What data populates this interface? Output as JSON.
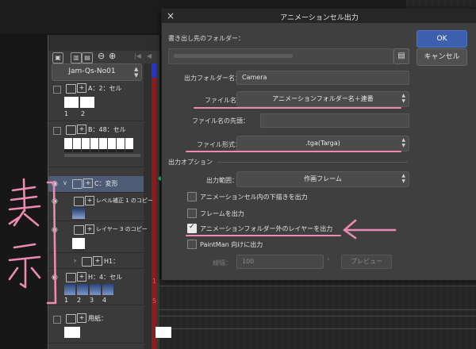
{
  "timeline": {
    "sequence": "Jam-Qs-No01",
    "rows": [
      {
        "label": "A：2：セル",
        "nums": [
          "1",
          "2"
        ]
      },
      {
        "label": "B：48：セル"
      },
      {
        "label": "C：変形"
      },
      {
        "label": "レベル補正 1 のコピー"
      },
      {
        "label": "レイヤー 3 のコピー"
      },
      {
        "label": "H1："
      },
      {
        "label": "H：4：セル",
        "nums": [
          "1",
          "2",
          "3",
          "4"
        ]
      },
      {
        "label": "用紙："
      }
    ],
    "frame_marks": [
      "1",
      "5"
    ]
  },
  "annotation": {
    "handwriting": "表示",
    "color": "#ec8ab2"
  },
  "dialog": {
    "title": "アニメーションセル出力",
    "ok": "OK",
    "cancel": "キャンセル",
    "dest_folder_label": "書き出し先のフォルダー：",
    "output_folder_label": "出力フォルダー名：",
    "output_folder_value": "Camera",
    "filename_label": "ファイル名：",
    "filename_value": "アニメーションフォルダー名＋連番",
    "filename_prefix_label": "ファイル名の先頭：",
    "filename_prefix_value": "",
    "format_label": "ファイル形式：",
    "format_value": ".tga(Targa)",
    "options_section": "出力オプション",
    "range_label": "出力範囲：",
    "range_value": "作画フレーム",
    "checkboxes": [
      {
        "label": "アニメーションセル内の下描きを出力",
        "checked": false
      },
      {
        "label": "フレームを出力",
        "checked": false
      },
      {
        "label": "アニメーションフォルダー外のレイヤーを出力",
        "checked": true
      },
      {
        "label": "PaintMan 向けに出力",
        "checked": false
      }
    ],
    "scale_label": "線幅：",
    "scale_value": "100",
    "preview": "プレビュー"
  },
  "colors": {
    "accent_blue": "#3d5fae",
    "highlight_pink": "#ec8ab2"
  }
}
